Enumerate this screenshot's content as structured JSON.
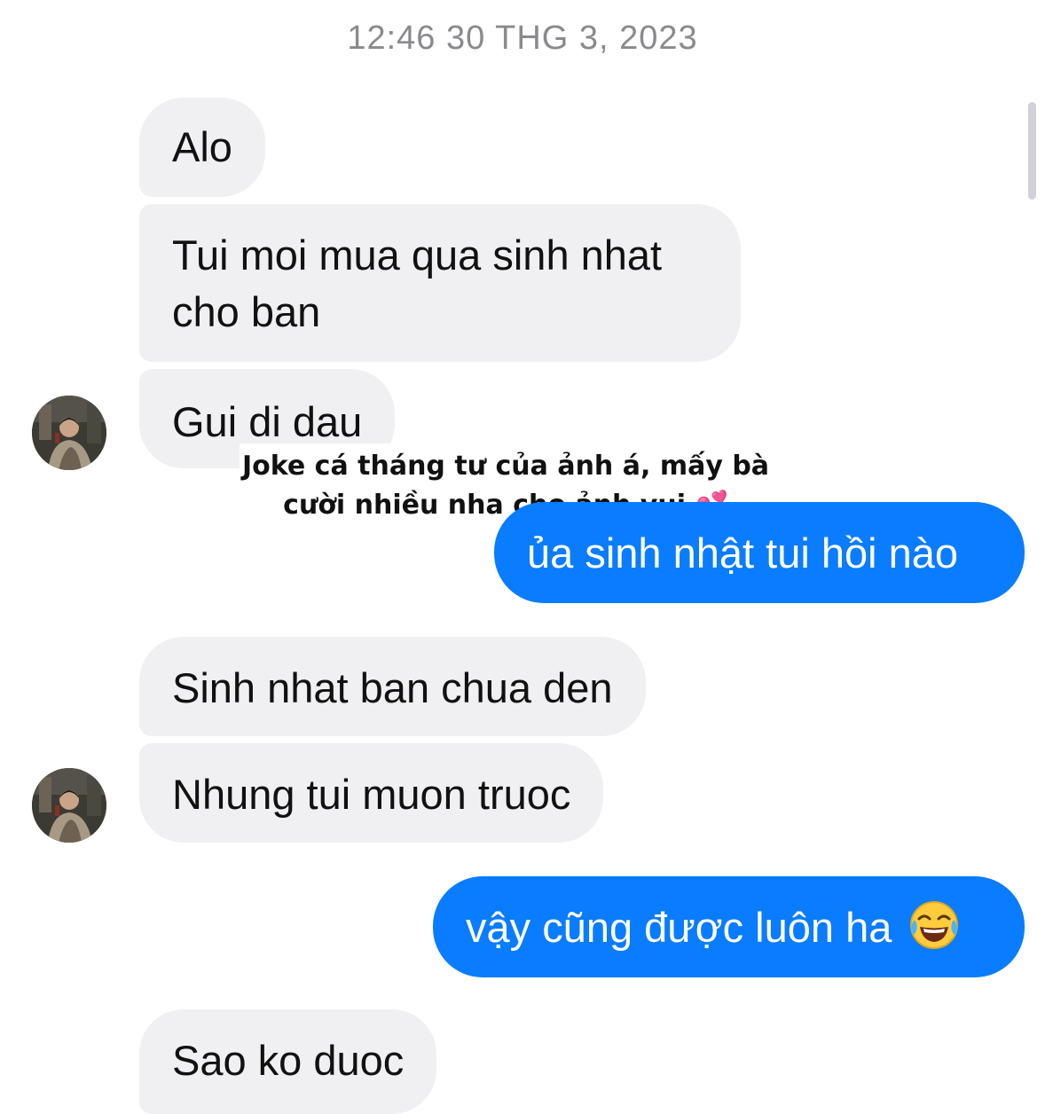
{
  "timestamp": "12:46 30 THG 3, 2023",
  "messages": [
    {
      "side": "in",
      "text": "Alo"
    },
    {
      "side": "in",
      "line1": "Tui moi mua qua sinh nhat",
      "line2": "cho ban"
    },
    {
      "side": "in",
      "text": "Gui di dau"
    },
    {
      "side": "out",
      "text": "ủa sinh nhật tui hồi nào"
    },
    {
      "side": "in",
      "text": "Sinh nhat ban chua den"
    },
    {
      "side": "in",
      "text": "Nhung tui muon truoc"
    },
    {
      "side": "out",
      "text": "vậy cũng được luôn ha",
      "emoji": "face-with-tears-of-joy-icon"
    },
    {
      "side": "in",
      "text": "Sao ko duoc"
    }
  ],
  "caption": {
    "line1": "Joke cá tháng tư của ảnh á, mấy bà",
    "line2": "cười nhiều nha cho ảnh vui",
    "emoji": "💕"
  },
  "colors": {
    "outgoing_bubble": "#0a7cff",
    "incoming_bubble": "#f0f0f2",
    "timestamp_text": "#8a8a8e",
    "heart": "#f25aa8"
  }
}
